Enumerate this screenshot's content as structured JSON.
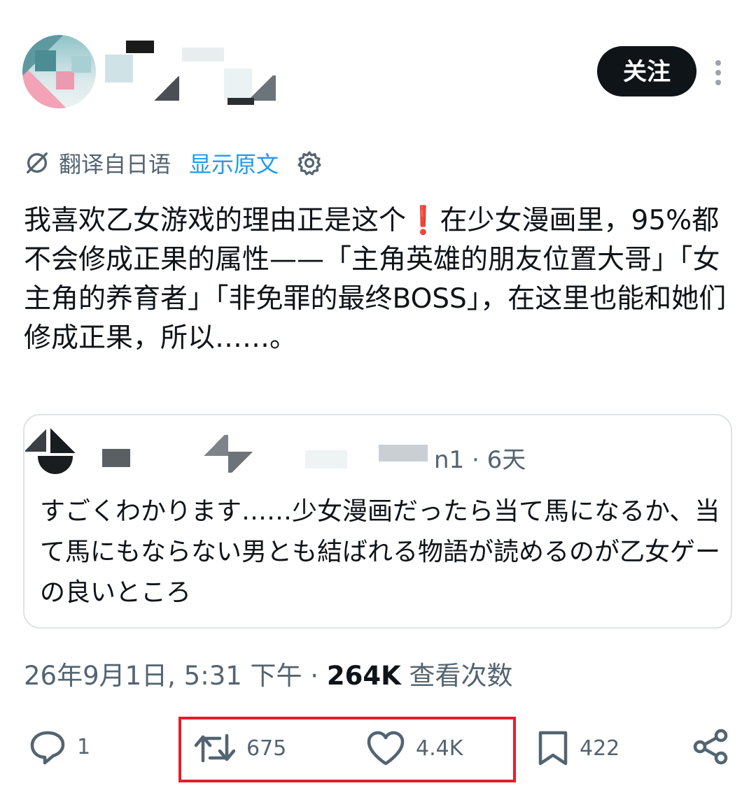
{
  "header": {
    "follow_label": "关注"
  },
  "translation": {
    "label": "翻译自日语",
    "show_original": "显示原文"
  },
  "tweet": {
    "text": "我喜欢乙女游戏的理由正是这个❗在少女漫画里，95%都不会修成正果的属性——「主角英雄的朋友位置大哥」「女主角的养育者」「非免罪的最终BOSS」，在这里也能和她们修成正果，所以……。"
  },
  "quote": {
    "handle_fragment": "n1",
    "time": "6天",
    "text": "すごくわかります……少女漫画だったら当て馬になるか、当て馬にもならない男とも結ばれる物語が読めるのが乙女ゲーの良いところ"
  },
  "meta": {
    "datetime": "26年9月1日, 5:31 下午",
    "views": "264K",
    "views_label": "查看次数"
  },
  "actions": {
    "replies": "1",
    "retweets": "675",
    "likes": "4.4K",
    "bookmarks": "422"
  },
  "colors": {
    "accent": "#1d9bf0",
    "highlight": "#e0202b",
    "text": "#0f1419",
    "muted": "#536471"
  }
}
